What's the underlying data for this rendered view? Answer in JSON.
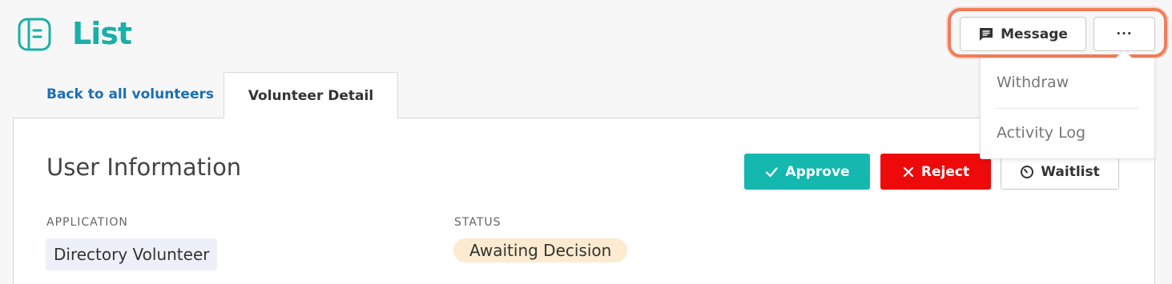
{
  "header": {
    "title": "List",
    "logo_icon": "book-icon",
    "accent_color": "#1ab0a7"
  },
  "toolbar": {
    "message_label": "Message",
    "message_icon": "chat-icon",
    "more_label": "•••",
    "more_icon": "ellipsis-icon"
  },
  "dropdown": {
    "items": [
      {
        "label": "Withdraw"
      },
      {
        "label": "Activity Log"
      }
    ]
  },
  "tabs": {
    "back_label": "Back to all volunteers",
    "active_label": "Volunteer Detail"
  },
  "panel": {
    "title": "User Information",
    "actions": {
      "approve_label": "Approve",
      "approve_color": "#14b8ae",
      "reject_label": "Reject",
      "reject_color": "#ee0a0a",
      "waitlist_label": "Waitlist"
    },
    "fields": {
      "application_label": "APPLICATION",
      "application_value": "Directory Volunteer",
      "status_label": "STATUS",
      "status_value": "Awaiting Decision"
    }
  },
  "highlight_color": "#f07d5a"
}
